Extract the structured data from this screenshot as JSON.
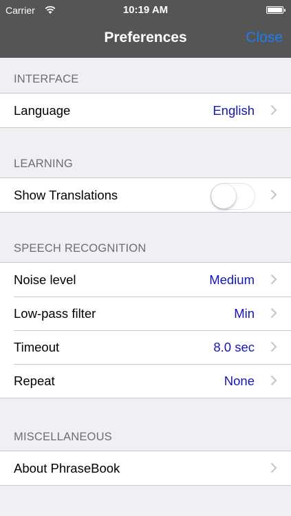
{
  "status_bar": {
    "carrier": "Carrier",
    "time": "10:19 AM",
    "icons": [
      "wifi-icon",
      "battery-icon"
    ]
  },
  "navbar": {
    "title": "Preferences",
    "close_label": "Close"
  },
  "colors": {
    "header_bg": "#555555",
    "accent_blue": "#1e7ff0",
    "value_blue": "#1515b8",
    "background": "#efeff4",
    "section_text": "#6d6d72"
  },
  "sections": [
    {
      "header": "INTERFACE",
      "rows": [
        {
          "label": "Language",
          "value": "English",
          "accessory": "chevron"
        }
      ]
    },
    {
      "header": "LEARNING",
      "rows": [
        {
          "label": "Show Translations",
          "toggle": false,
          "accessory": "chevron"
        }
      ]
    },
    {
      "header": "SPEECH RECOGNITION",
      "rows": [
        {
          "label": "Noise level",
          "value": "Medium",
          "accessory": "chevron"
        },
        {
          "label": "Low-pass filter",
          "value": "Min",
          "accessory": "chevron"
        },
        {
          "label": "Timeout",
          "value": "8.0 sec",
          "accessory": "chevron"
        },
        {
          "label": "Repeat",
          "value": "None",
          "accessory": "chevron"
        }
      ]
    },
    {
      "header": "MISCELLANEOUS",
      "rows": [
        {
          "label": "About PhraseBook",
          "accessory": "chevron"
        }
      ]
    }
  ]
}
